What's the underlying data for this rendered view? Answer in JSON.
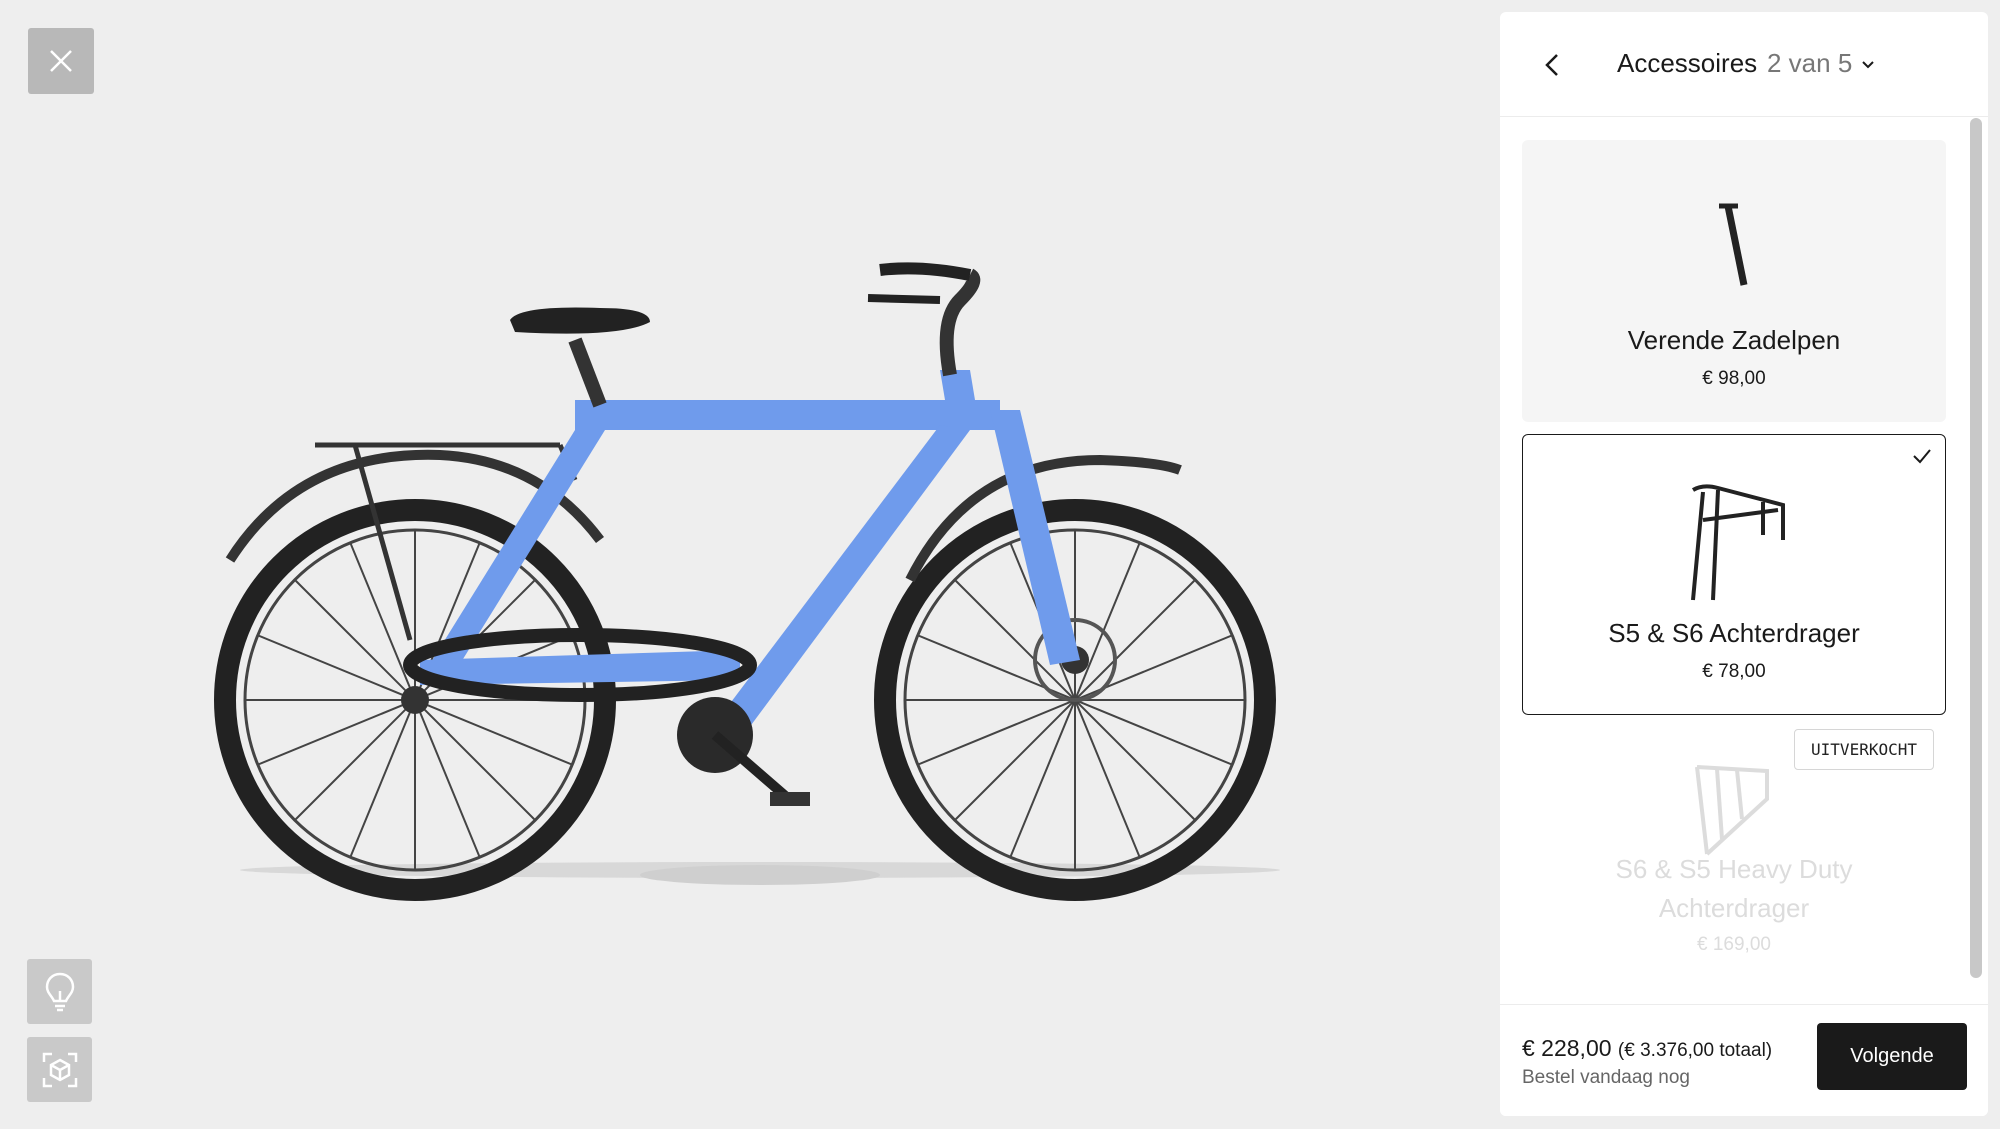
{
  "viewer": {
    "close_icon": "close-icon",
    "lightbulb_icon": "lightbulb-icon",
    "ar_icon": "ar-view-icon",
    "bike_color": "#6f9bec"
  },
  "panel": {
    "back_icon": "chevron-left-icon",
    "title": "Accessoires",
    "step": "2 van 5",
    "step_icon": "chevron-down-icon",
    "products": [
      {
        "name": "Verende Zadelpen",
        "price": "€ 98,00",
        "selected": false,
        "sold_out": false
      },
      {
        "name": "S5 & S6 Achterdrager",
        "price": "€ 78,00",
        "selected": true,
        "sold_out": false
      },
      {
        "name_line1": "S6 & S5 Heavy Duty",
        "name_line2": "Achterdrager",
        "price": "€ 169,00",
        "selected": false,
        "sold_out": true,
        "badge": "UITVERKOCHT"
      }
    ],
    "footer": {
      "price": "€ 228,00",
      "total": "(€ 3.376,00 totaal)",
      "subtext": "Bestel vandaag nog",
      "next_label": "Volgende"
    }
  }
}
